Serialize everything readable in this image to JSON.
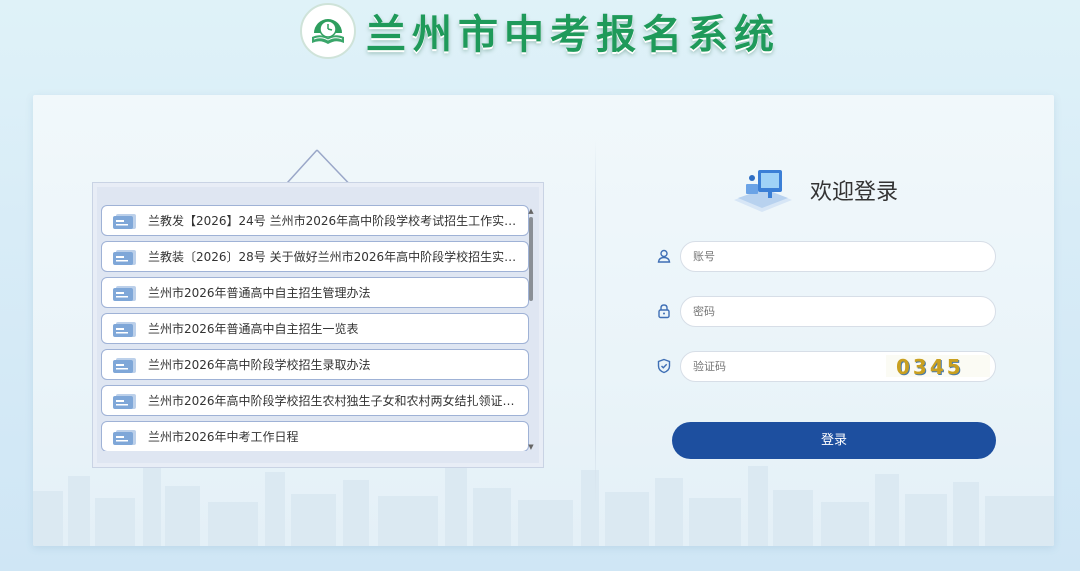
{
  "header": {
    "title": "兰州市中考报名系统"
  },
  "notices": {
    "items": [
      {
        "label": "兰教发【2026】24号 兰州市2026年高中阶段学校考试招生工作实施…"
      },
      {
        "label": "兰教装〔2026〕28号 关于做好兰州市2026年高中阶段学校招生实验…"
      },
      {
        "label": "兰州市2026年普通高中自主招生管理办法"
      },
      {
        "label": "兰州市2026年普通高中自主招生一览表"
      },
      {
        "label": "兰州市2026年高中阶段学校招生录取办法"
      },
      {
        "label": "兰州市2026年高中阶段学校招生农村独生子女和农村两女结扎领证…"
      },
      {
        "label": "兰州市2026年中考工作日程"
      }
    ]
  },
  "login": {
    "title": "欢迎登录",
    "account_placeholder": "账号",
    "password_placeholder": "密码",
    "captcha_placeholder": "验证码",
    "captcha_code": "0345",
    "submit_label": "登录"
  },
  "icons": {
    "logo": "school-book-clock-logo",
    "account": "user-icon",
    "password": "lock-icon",
    "captcha": "shield-icon",
    "notice": "document-icon"
  },
  "colors": {
    "title_green": "#1f9a5a",
    "button_blue": "#1d4f9f",
    "notice_border": "#9fb2d6"
  }
}
